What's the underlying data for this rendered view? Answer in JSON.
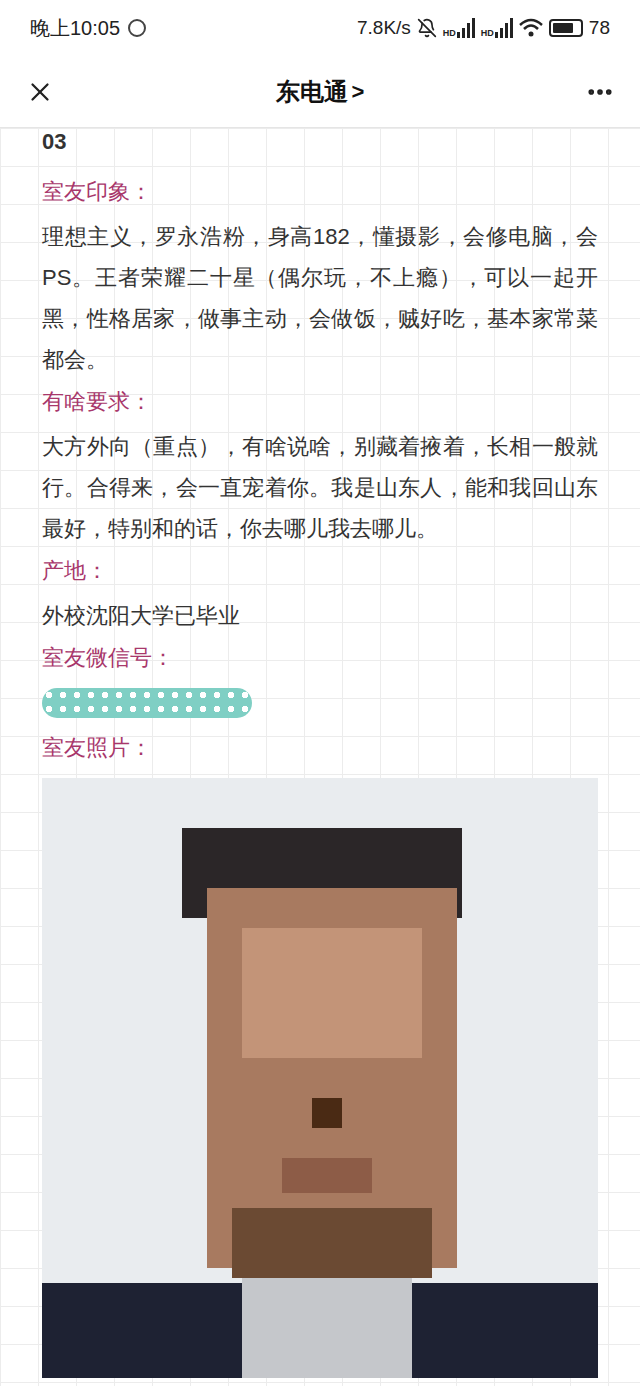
{
  "status_bar": {
    "time": "晚上10:05",
    "speed": "7.8K/s",
    "hd": [
      "HD",
      "HD"
    ],
    "battery": "78",
    "battery_level": 0.78
  },
  "header": {
    "title": "东电通",
    "chevron": ">"
  },
  "article": {
    "section_number": "03",
    "sections": [
      {
        "kind": "text",
        "label": "室友印象：",
        "body": "理想主义，罗永浩粉，身高182，懂摄影，会修电脑，会PS。王者荣耀二十星（偶尔玩，不上瘾），可以一起开黑，性格居家，做事主动，会做饭，贼好吃，基本家常菜都会。"
      },
      {
        "kind": "text",
        "label": "有啥要求：",
        "body": "大方外向（重点），有啥说啥，别藏着掖着，长相一般就行。合得来，会一直宠着你。我是山东人，能和我回山东最好，特别和的话，你去哪儿我去哪儿。"
      },
      {
        "kind": "text",
        "label": "产地：",
        "body": "外校沈阳大学已毕业"
      },
      {
        "kind": "redacted",
        "label": "室友微信号："
      },
      {
        "kind": "photo",
        "label": "室友照片："
      }
    ]
  }
}
